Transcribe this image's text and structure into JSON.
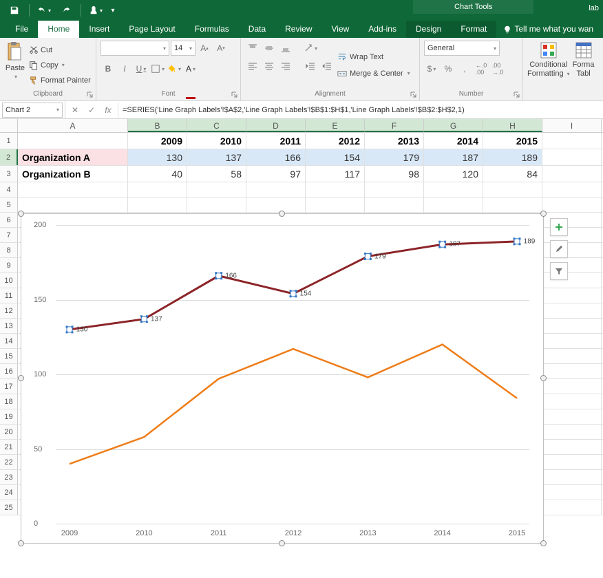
{
  "titlebar": {
    "chart_tools_label": "Chart Tools",
    "filename": "lab"
  },
  "tabs": {
    "file": "File",
    "home": "Home",
    "insert": "Insert",
    "page_layout": "Page Layout",
    "formulas": "Formulas",
    "data": "Data",
    "review": "Review",
    "view": "View",
    "addins": "Add-ins",
    "design": "Design",
    "format": "Format",
    "tellme": "Tell me what you wan"
  },
  "ribbon": {
    "clipboard": {
      "paste": "Paste",
      "cut": "Cut",
      "copy": "Copy",
      "format_painter": "Format Painter",
      "label": "Clipboard"
    },
    "font": {
      "font_name": "",
      "size": "14",
      "bold": "B",
      "italic": "I",
      "underline": "U",
      "label": "Font"
    },
    "alignment": {
      "wrap": "Wrap Text",
      "merge": "Merge & Center",
      "label": "Alignment"
    },
    "number": {
      "format": "General",
      "label": "Number"
    },
    "styles": {
      "conditional": "Conditional",
      "formatting": "Formatting",
      "formatas": "Forma",
      "table": "Tabl",
      "label": ""
    }
  },
  "formula_bar": {
    "namebox": "Chart 2",
    "fx": "fx",
    "formula": "=SERIES('Line Graph Labels'!$A$2,'Line Graph Labels'!$B$1:$H$1,'Line Graph Labels'!$B$2:$H$2,1)"
  },
  "columns": [
    "A",
    "B",
    "C",
    "D",
    "E",
    "F",
    "G",
    "H",
    "I"
  ],
  "rows_visible": [
    1,
    2,
    3,
    4,
    5,
    6,
    7,
    8,
    9,
    10,
    11,
    12,
    13,
    14,
    15,
    16,
    17,
    18,
    19,
    20,
    21,
    22,
    23,
    24,
    25
  ],
  "table": {
    "years": [
      "2009",
      "2010",
      "2011",
      "2012",
      "2013",
      "2014",
      "2015"
    ],
    "orgA_label": "Organization A",
    "orgA": [
      "130",
      "137",
      "166",
      "154",
      "179",
      "187",
      "189"
    ],
    "orgB_label": "Organization B",
    "orgB": [
      "40",
      "58",
      "97",
      "117",
      "98",
      "120",
      "84"
    ]
  },
  "chart_data": {
    "type": "line",
    "categories": [
      "2009",
      "2010",
      "2011",
      "2012",
      "2013",
      "2014",
      "2015"
    ],
    "series": [
      {
        "name": "Organization A",
        "values": [
          130,
          137,
          166,
          154,
          179,
          187,
          189
        ],
        "color": "#8c2428",
        "labels_visible": true,
        "selected": true
      },
      {
        "name": "Organization B",
        "values": [
          40,
          58,
          97,
          117,
          98,
          120,
          84
        ],
        "color": "#ef7c17",
        "labels_visible": false
      }
    ],
    "ylim": [
      0,
      200
    ],
    "yticks": [
      0,
      50,
      100,
      150,
      200
    ],
    "xlabel": "",
    "ylabel": "",
    "title": ""
  },
  "chart_buttons": {
    "plus": "+",
    "brush": "brush",
    "filter": "filter"
  },
  "colors": {
    "accent": "#217346",
    "series_a": "#8c2428",
    "series_b": "#ef7c17"
  }
}
